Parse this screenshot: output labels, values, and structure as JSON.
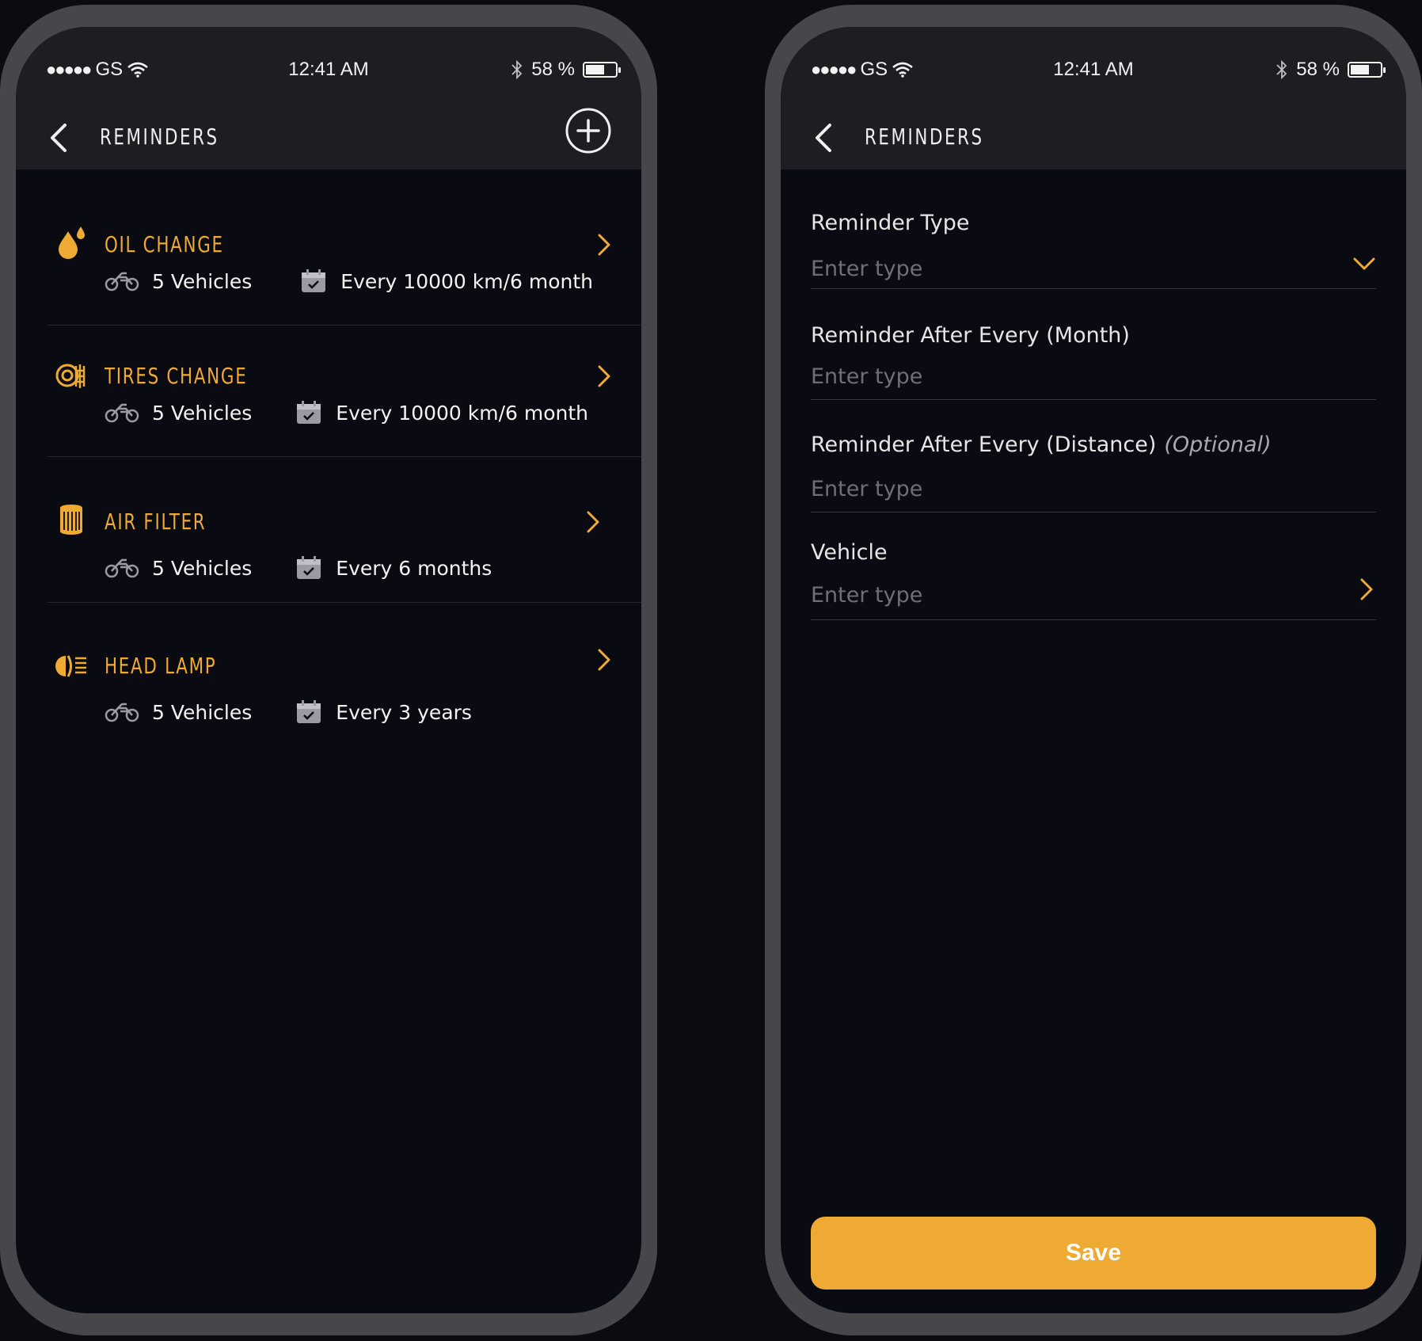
{
  "status": {
    "carrier": "GS",
    "time": "12:41 AM",
    "battery": "58 %",
    "battery_level": 0.58
  },
  "colors": {
    "accent": "#eeaa33",
    "background": "#0a0a12",
    "header": "#1d1d22"
  },
  "list_screen": {
    "title": "REMINDERS",
    "items": [
      {
        "title": "OIL CHANGE",
        "icon": "oil-drop-icon",
        "vehicles": "5 Vehicles",
        "schedule": "Every 10000 km/6 month"
      },
      {
        "title": "TIRES CHANGE",
        "icon": "tire-icon",
        "vehicles": "5 Vehicles",
        "schedule": "Every 10000 km/6 month"
      },
      {
        "title": "AIR FILTER",
        "icon": "air-filter-icon",
        "vehicles": "5 Vehicles",
        "schedule": "Every 6 months"
      },
      {
        "title": "HEAD LAMP",
        "icon": "head-lamp-icon",
        "vehicles": "5 Vehicles",
        "schedule": "Every 3 years"
      }
    ]
  },
  "form_screen": {
    "title": "REMINDERS",
    "fields": [
      {
        "label": "Reminder Type",
        "optional": "",
        "placeholder": "Enter type",
        "control": "dropdown"
      },
      {
        "label": "Reminder After Every (Month)",
        "optional": "",
        "placeholder": "Enter type",
        "control": "text"
      },
      {
        "label": "Reminder After Every (Distance)",
        "optional": "(Optional)",
        "placeholder": "Enter type",
        "control": "text"
      },
      {
        "label": "Vehicle",
        "optional": "",
        "placeholder": "Enter type",
        "control": "navigate"
      }
    ],
    "save_label": "Save"
  }
}
